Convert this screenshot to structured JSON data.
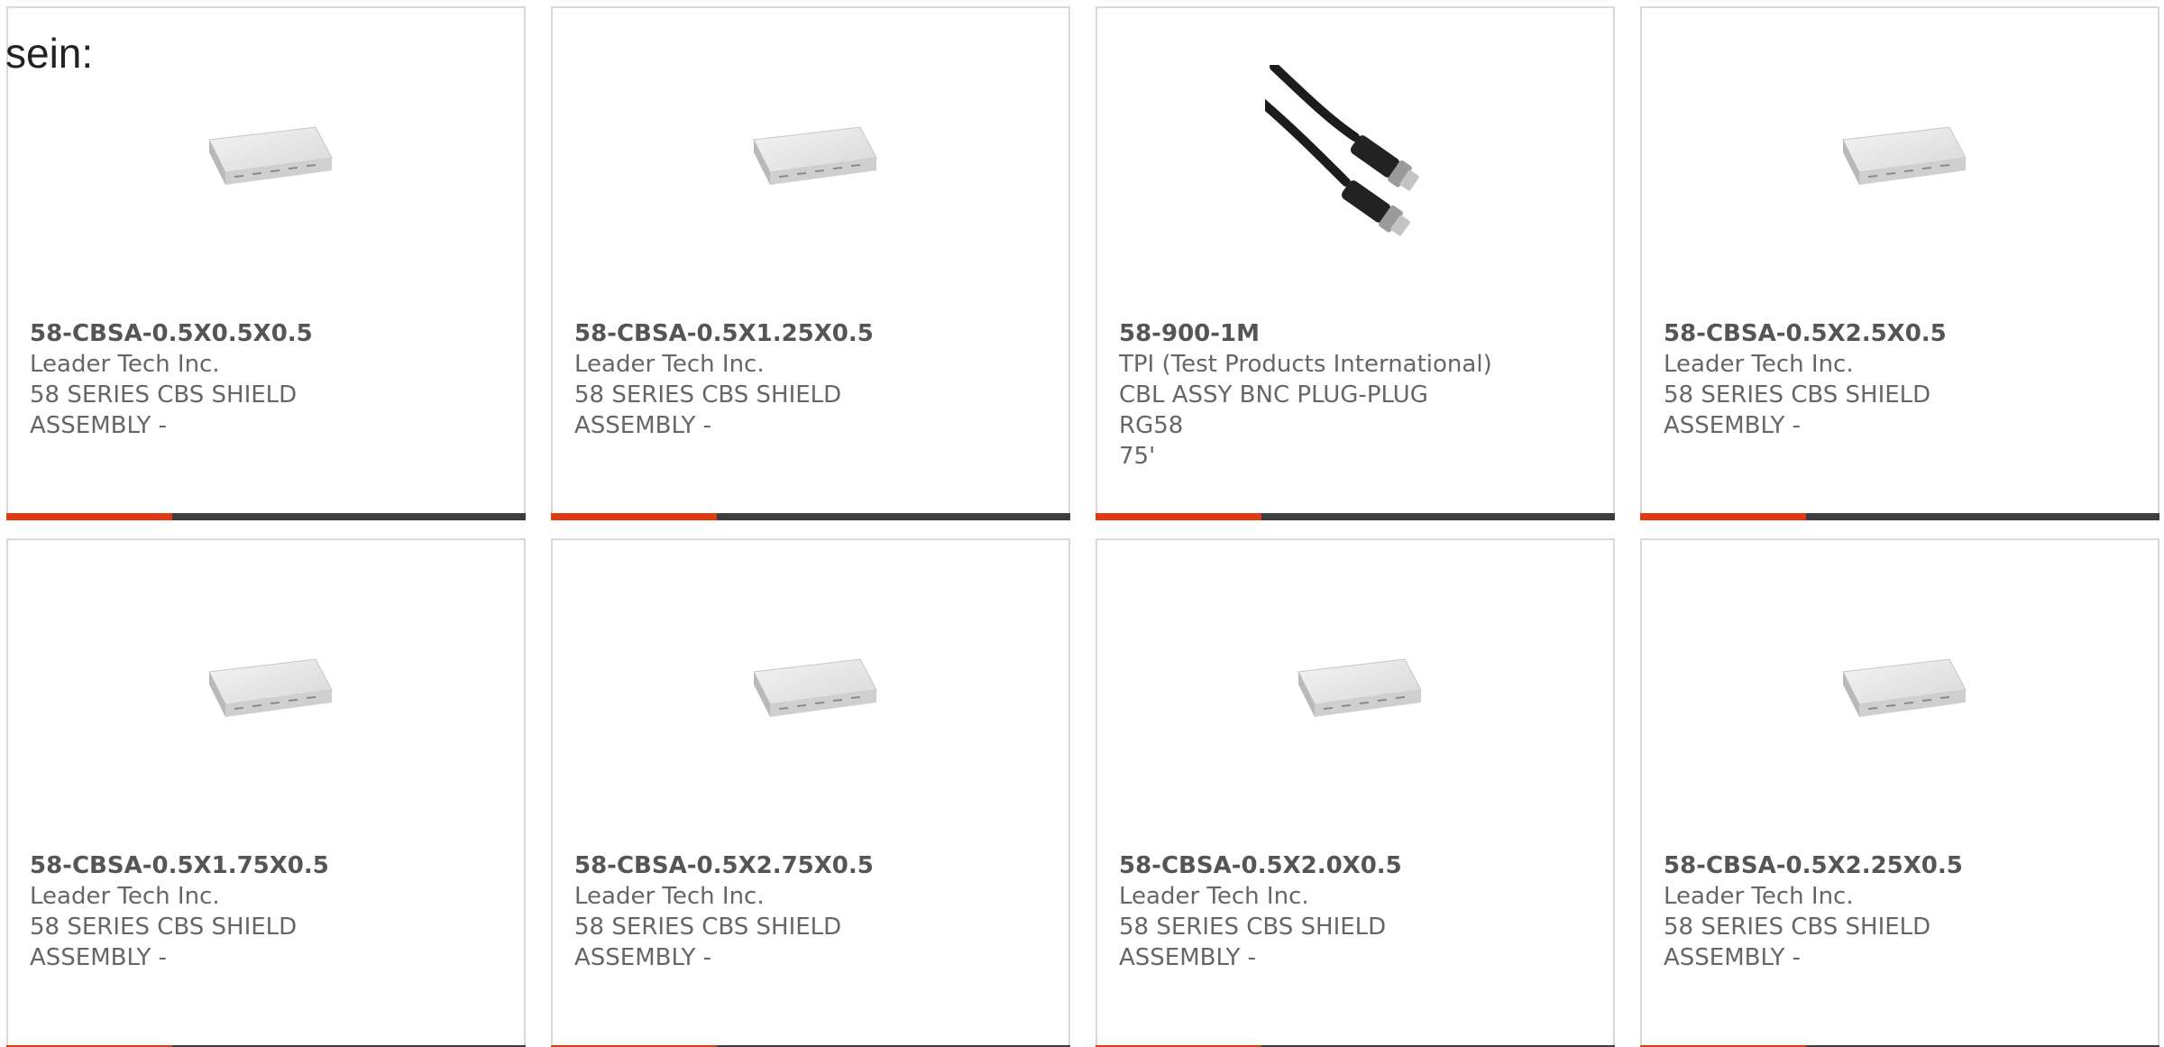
{
  "intro_text": "sein:",
  "colors": {
    "accent": "#e03a12",
    "bar": "#3b3d3f",
    "border": "#d9d9d9",
    "text": "#666666"
  },
  "products": [
    {
      "part": "58-CBSA-0.5X0.5X0.5",
      "manufacturer": "Leader Tech Inc.",
      "desc1": "58 SERIES CBS SHIELD",
      "desc2": "ASSEMBLY -",
      "image": "shield-can-image"
    },
    {
      "part": "58-CBSA-0.5X1.25X0.5",
      "manufacturer": "Leader Tech Inc.",
      "desc1": "58 SERIES CBS SHIELD",
      "desc2": "ASSEMBLY -",
      "image": "shield-can-image"
    },
    {
      "part": "58-900-1M",
      "manufacturer": "TPI (Test Products International)",
      "desc1": "CBL ASSY BNC PLUG-PLUG RG58",
      "desc2": "75'",
      "image": "bnc-cable-image"
    },
    {
      "part": "58-CBSA-0.5X2.5X0.5",
      "manufacturer": "Leader Tech Inc.",
      "desc1": "58 SERIES CBS SHIELD",
      "desc2": "ASSEMBLY -",
      "image": "shield-can-image"
    },
    {
      "part": "58-CBSA-0.5X1.75X0.5",
      "manufacturer": "Leader Tech Inc.",
      "desc1": "58 SERIES CBS SHIELD",
      "desc2": "ASSEMBLY -",
      "image": "shield-can-image"
    },
    {
      "part": "58-CBSA-0.5X2.75X0.5",
      "manufacturer": "Leader Tech Inc.",
      "desc1": "58 SERIES CBS SHIELD",
      "desc2": "ASSEMBLY -",
      "image": "shield-can-image"
    },
    {
      "part": "58-CBSA-0.5X2.0X0.5",
      "manufacturer": "Leader Tech Inc.",
      "desc1": "58 SERIES CBS SHIELD",
      "desc2": "ASSEMBLY -",
      "image": "shield-can-image"
    },
    {
      "part": "58-CBSA-0.5X2.25X0.5",
      "manufacturer": "Leader Tech Inc.",
      "desc1": "58 SERIES CBS SHIELD",
      "desc2": "ASSEMBLY -",
      "image": "shield-can-image"
    }
  ]
}
